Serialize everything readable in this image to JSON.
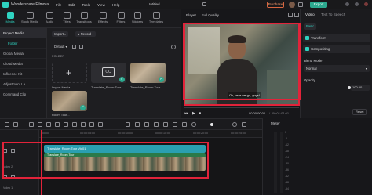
{
  "app": {
    "name": "Wondershare Filmora",
    "menu": [
      "File",
      "Edit",
      "Tools",
      "View",
      "Help"
    ],
    "project_title": "Untitled",
    "purchase_label": "Purchase",
    "export_label": "Export"
  },
  "media_tabs": [
    {
      "label": "Media",
      "icon": "media-icon",
      "active": true
    },
    {
      "label": "Stock Media",
      "icon": "stock-icon",
      "active": false
    },
    {
      "label": "Audio",
      "icon": "audio-icon",
      "active": false
    },
    {
      "label": "Titles",
      "icon": "titles-icon",
      "active": false
    },
    {
      "label": "Transitions",
      "icon": "transitions-icon",
      "active": false
    },
    {
      "label": "Effects",
      "icon": "effects-icon",
      "active": false
    },
    {
      "label": "Filters",
      "icon": "filters-icon",
      "active": false
    },
    {
      "label": "Stickers",
      "icon": "stickers-icon",
      "active": false
    },
    {
      "label": "Templates",
      "icon": "templates-icon",
      "active": false
    }
  ],
  "sidebar": {
    "items": [
      "Project Media",
      "Folder",
      "Global Media",
      "Cloud Media",
      "Influence Kit",
      "Adjustment La...",
      "Command Clip"
    ]
  },
  "media": {
    "import_label": "Import",
    "record_label": "Record",
    "sort_label": "Default",
    "folder_label": "FOLDER",
    "import_media_caption": "Import Media",
    "clip_caption_1": "Translate_Room Tour...",
    "clip_caption_2": "Translate_Room Tour ...",
    "clip_caption_3": "Room Tour..."
  },
  "player": {
    "label": "Player",
    "quality": "Full Quality",
    "subtitle": "Ok, here we go, guys!",
    "current_time": "00:00:00:00",
    "total_time": "00:01:01:01"
  },
  "properties": {
    "tabs": [
      "Video",
      "Text To Speech"
    ],
    "sub_tab": "Basic",
    "transform_label": "Transform",
    "compositing_label": "Compositing",
    "blend_mode_label": "Blend Mode",
    "blend_mode_value": "Normal",
    "opacity_label": "Opacity",
    "opacity_value": "100.00",
    "opacity_level": 1.0,
    "reset_label": "Reset"
  },
  "timeline": {
    "meter_label": "Meter",
    "ruler_ticks": [
      "00:00",
      "00:00:05:00",
      "00:00:10:00",
      "00:00:15:00",
      "00:00:20:00",
      "00:00:25:00"
    ],
    "subtitle_clip_label": "Translate_Room Tour Vid01",
    "video_clip_label": "Translate_Room Tour",
    "track_label_video2": "Video 2",
    "track_label_video1": "Video 1",
    "meter_scale": [
      "0",
      "-6",
      "-12",
      "-18",
      "-24",
      "-30",
      "-36",
      "-42",
      "-48",
      "-54"
    ]
  },
  "colors": {
    "accent": "#2fd3c1",
    "highlight_box": "#e2233a",
    "export": "#2ca98f",
    "subtitle_track": "#2a9fb1",
    "video_track": "#2a7a4a"
  }
}
